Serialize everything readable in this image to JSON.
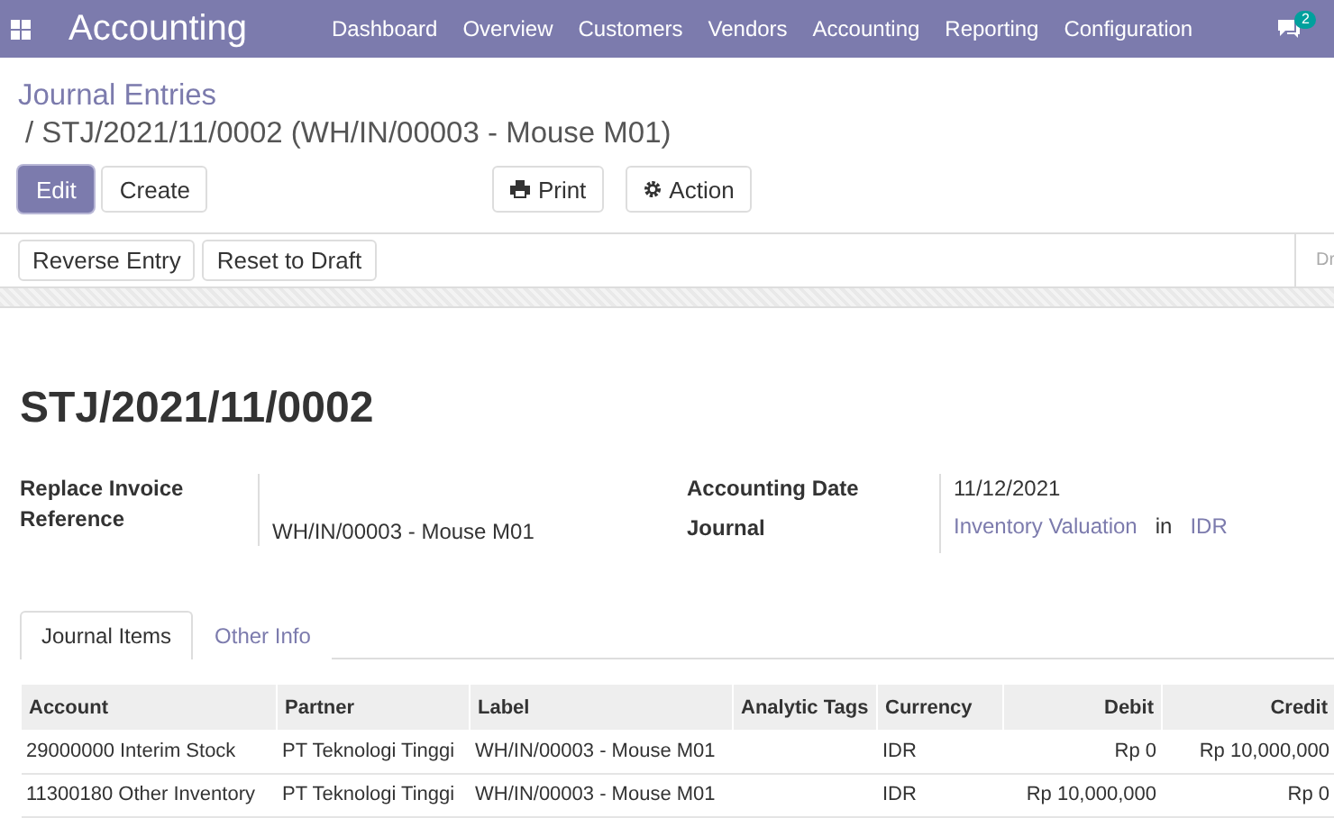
{
  "navbar": {
    "app_name": "Accounting",
    "menu": [
      {
        "label": "Dashboard"
      },
      {
        "label": "Overview"
      },
      {
        "label": "Customers"
      },
      {
        "label": "Vendors"
      },
      {
        "label": "Accounting"
      },
      {
        "label": "Reporting"
      },
      {
        "label": "Configuration"
      }
    ],
    "message_count": "2"
  },
  "breadcrumb": {
    "parent": "Journal Entries",
    "current": "/ STJ/2021/11/0002 (WH/IN/00003 - Mouse M01)"
  },
  "buttons": [
    {
      "label": "Edit",
      "kind": "primary"
    },
    {
      "label": "Create",
      "kind": "plain"
    }
  ],
  "actions": [
    {
      "label": "Print",
      "kind": "print"
    },
    {
      "label": "Action",
      "kind": "gear"
    }
  ],
  "status_buttons": [
    "Reverse Entry",
    "Reset to Draft"
  ],
  "status_bar": {
    "stage": "Dr"
  },
  "title": "STJ/2021/11/0002",
  "fields_left": {
    "label": "Replace Invoice Reference",
    "value": "WH/IN/00003 - Mouse M01"
  },
  "fields_right": {
    "date_label": "Accounting Date",
    "date": "11/12/2021",
    "journal_label": "Journal",
    "journal": "Inventory Valuation",
    "in": "in",
    "currency": "IDR"
  },
  "tabs": [
    {
      "label": "Journal Items",
      "selected": true
    },
    {
      "label": "Other Info",
      "selected": false
    }
  ],
  "table": {
    "columns": [
      {
        "label": "Account",
        "kind": "text"
      },
      {
        "label": "Partner",
        "kind": "text"
      },
      {
        "label": "Label",
        "kind": "text"
      },
      {
        "label": "Analytic Tags",
        "kind": "text"
      },
      {
        "label": "Currency",
        "kind": "text"
      },
      {
        "label": "Debit",
        "kind": "amount"
      },
      {
        "label": "Credit",
        "kind": "amount"
      }
    ],
    "rows": [
      [
        "29000000 Interim Stock",
        "PT Teknologi Tinggi",
        "WH/IN/00003 - Mouse M01",
        "",
        "IDR",
        "Rp 0",
        "Rp 10,000,000"
      ],
      [
        "11300180 Other Inventory",
        "PT Teknologi Tinggi",
        "WH/IN/00003 - Mouse M01",
        "",
        "IDR",
        "Rp 10,000,000",
        "Rp 0"
      ]
    ]
  }
}
